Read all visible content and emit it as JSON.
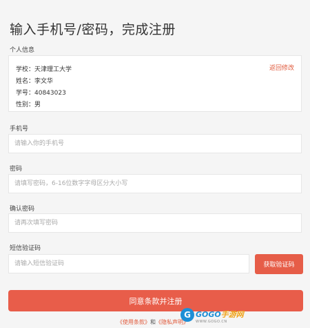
{
  "page": {
    "title": "输入手机号/密码，完成注册"
  },
  "personal_info": {
    "section_label": "个人信息",
    "edit_link": "返回修改",
    "lines": [
      "学校：天津理工大学",
      "姓名：李文华",
      "学号：40843023",
      "性别：男"
    ]
  },
  "form": {
    "phone": {
      "label": "手机号",
      "placeholder": "请输入你的手机号",
      "value": ""
    },
    "password": {
      "label": "密码",
      "placeholder": "请填写密码，6-16位数字字母区分大小写",
      "value": ""
    },
    "confirm_password": {
      "label": "确认密码",
      "placeholder": "请再次填写密码",
      "value": ""
    },
    "sms_code": {
      "label": "短信验证码",
      "placeholder": "请输入短信验证码",
      "value": ""
    },
    "get_code_button": "获取验证码",
    "submit_button": "同意条款并注册"
  },
  "terms": {
    "terms_link": "《使用条款》",
    "and": "和",
    "privacy_link": "《隐私声明》"
  },
  "watermark": {
    "logo_char": "G",
    "text_part1": "GOGO",
    "text_part2": "手游网",
    "sub": "WWW.GOGO.CN"
  },
  "colors": {
    "accent": "#e85d4a",
    "link": "#e05a3c",
    "background": "#f5f5f5"
  }
}
